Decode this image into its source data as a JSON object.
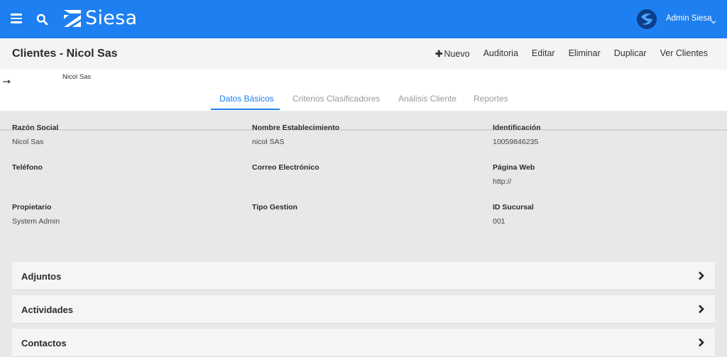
{
  "topbar": {
    "menu_icon": "hamburger-icon",
    "search_icon": "search-icon",
    "brand": "Siesa",
    "brand_color": "#1e7ff0",
    "user_name": "Admin Siesa"
  },
  "header": {
    "title": "Clientes - Nicol Sas",
    "actions": {
      "new": "Nuevo",
      "audit": "Auditoria",
      "edit": "Editar",
      "delete": "Eliminar",
      "duplicate": "Duplicar",
      "view_all": "Ver Clientes"
    }
  },
  "breadcrumb": {
    "current": "Nicol Sas"
  },
  "tabs": {
    "basic": "Datos Básicos",
    "criteria": "Criterios Clasificadores",
    "analysis": "Análisis Cliente",
    "reports": "Reportes",
    "active": "Datos Básicos"
  },
  "fields": {
    "razon_social": {
      "label": "Razón Social",
      "value": "Nicol Sas"
    },
    "nombre_establecimiento": {
      "label": "Nombre Establecimiento",
      "value": "nicol SAS"
    },
    "identificacion": {
      "label": "Identificación",
      "value": "10059846235"
    },
    "telefono": {
      "label": "Teléfono",
      "value": ""
    },
    "correo": {
      "label": "Correo Electrónico",
      "value": ""
    },
    "pagina_web": {
      "label": "Página Web",
      "value": "http://"
    },
    "propietario": {
      "label": "Propietario",
      "value": "System Admin"
    },
    "tipo_gestion": {
      "label": "Tipo Gestion",
      "value": ""
    },
    "id_sucursal": {
      "label": "ID Sucursal",
      "value": "001"
    }
  },
  "panels": {
    "attachments": "Adjuntos",
    "activities": "Actividades",
    "contacts": "Contactos"
  }
}
